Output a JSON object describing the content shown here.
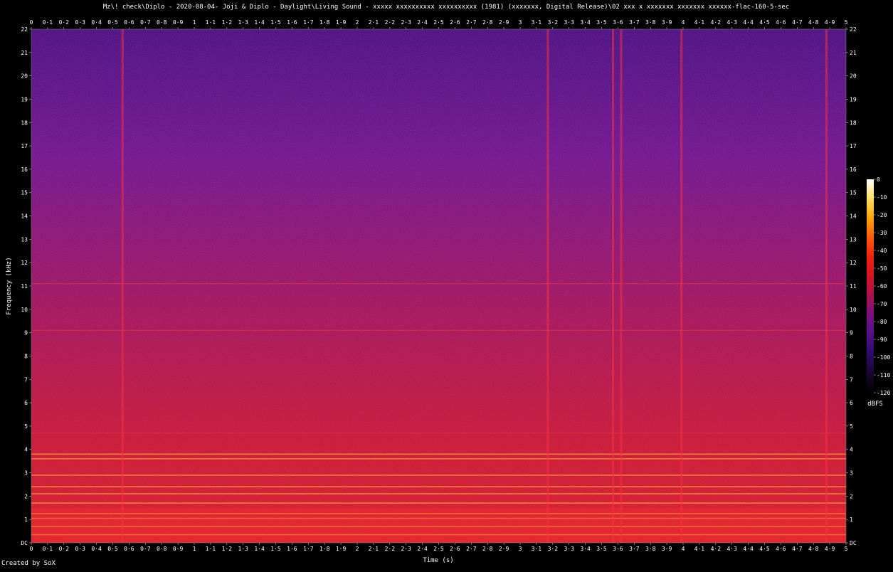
{
  "chart_data": {
    "type": "heatmap",
    "title": "Mz\\! check\\Diplo - 2020-08-04- Joji & Diplo - Daylight\\Living Sound - xxxxx xxxxxxxxxx xxxxxxxxxx (1981) (xxxxxxx, Digital Release)\\02 xxx x xxxxxxx xxxxxxx xxxxxx-flac-160-5-sec",
    "xlabel": "Time (s)",
    "ylabel": "Frequency (kHz)",
    "colorbar_label": "dBFS",
    "xlim": [
      0,
      5
    ],
    "ylim": [
      0,
      22
    ],
    "x_ticks": [
      "0",
      "0·1",
      "0·2",
      "0·3",
      "0·4",
      "0·5",
      "0·6",
      "0·7",
      "0·8",
      "0·9",
      "1",
      "1·1",
      "1·2",
      "1·3",
      "1·4",
      "1·5",
      "1·6",
      "1·7",
      "1·8",
      "1·9",
      "2",
      "2·1",
      "2·2",
      "2·3",
      "2·4",
      "2·5",
      "2·6",
      "2·7",
      "2·8",
      "2·9",
      "3",
      "3·1",
      "3·2",
      "3·3",
      "3·4",
      "3·5",
      "3·6",
      "3·7",
      "3·8",
      "3·9",
      "4",
      "4·1",
      "4·2",
      "4·3",
      "4·4",
      "4·5",
      "4·6",
      "4·7",
      "4·8",
      "4·9",
      "5"
    ],
    "y_ticks": [
      "DC",
      "1",
      "2",
      "3",
      "4",
      "5",
      "6",
      "7",
      "8",
      "9",
      "10",
      "11",
      "12",
      "13",
      "14",
      "15",
      "16",
      "17",
      "18",
      "19",
      "20",
      "21",
      "22"
    ],
    "colorbar_ticks": [
      "0",
      "-10",
      "-20",
      "-30",
      "-40",
      "-50",
      "-60",
      "-70",
      "-80",
      "-90",
      "-100",
      "-110",
      "-120"
    ],
    "colorbar_range": [
      -120,
      0
    ],
    "colormap": [
      "#000000",
      "#1a0530",
      "#300a6a",
      "#52108a",
      "#7a1080",
      "#a8124f",
      "#d41420",
      "#f02010",
      "#ff5a0a",
      "#ffa50a",
      "#ffe060",
      "#ffffff"
    ],
    "transients_s": [
      0.56,
      3.17,
      3.57,
      3.62,
      3.99,
      4.88
    ],
    "tonal_bands_khz": [
      0.35,
      0.7,
      1.05,
      1.25,
      1.7,
      2.1,
      2.4,
      2.9,
      3.6,
      3.8,
      4.7,
      9.1,
      11.1
    ]
  },
  "footer": {
    "credit": "Created by SoX"
  }
}
